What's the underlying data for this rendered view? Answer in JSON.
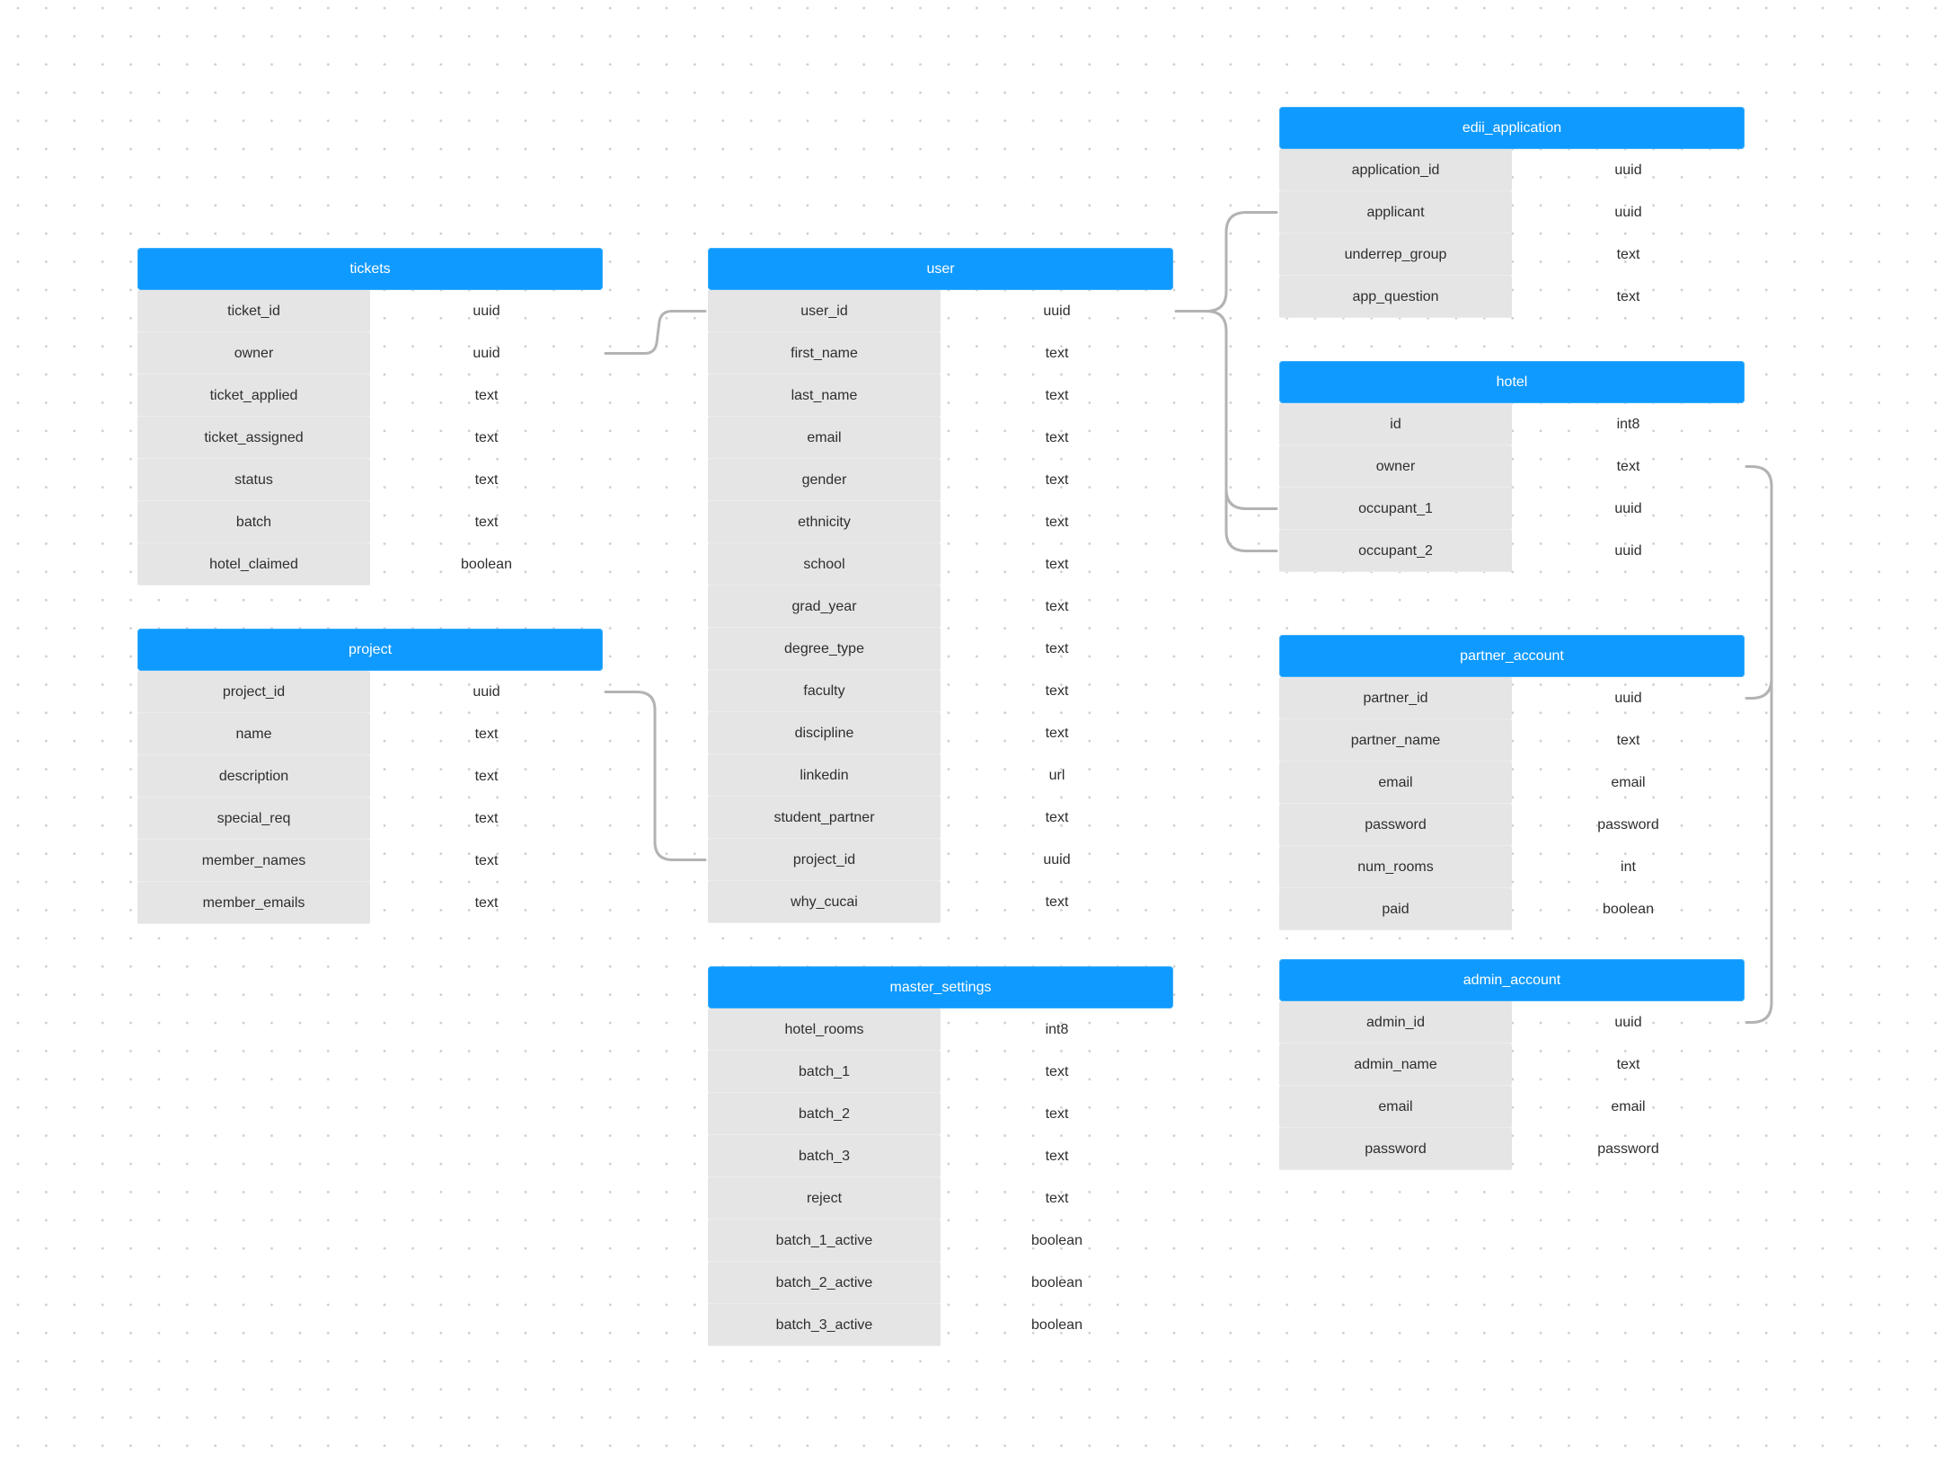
{
  "diagram": {
    "colors": {
      "header": "#0f9aff",
      "header_text": "#ffffff",
      "name_cell": "#e5e5e5",
      "text": "#2e2e2e",
      "connector": "#b3b3b3",
      "grid_dot": "#cfcfcf"
    },
    "tables": {
      "tickets": {
        "title": "tickets",
        "columns": [
          {
            "name": "ticket_id",
            "type": "uuid"
          },
          {
            "name": "owner",
            "type": "uuid"
          },
          {
            "name": "ticket_applied",
            "type": "text"
          },
          {
            "name": "ticket_assigned",
            "type": "text"
          },
          {
            "name": "status",
            "type": "text"
          },
          {
            "name": "batch",
            "type": "text"
          },
          {
            "name": "hotel_claimed",
            "type": "boolean"
          }
        ]
      },
      "project": {
        "title": "project",
        "columns": [
          {
            "name": "project_id",
            "type": "uuid"
          },
          {
            "name": "name",
            "type": "text"
          },
          {
            "name": "description",
            "type": "text"
          },
          {
            "name": "special_req",
            "type": "text"
          },
          {
            "name": "member_names",
            "type": "text"
          },
          {
            "name": "member_emails",
            "type": "text"
          }
        ]
      },
      "user": {
        "title": "user",
        "columns": [
          {
            "name": "user_id",
            "type": "uuid"
          },
          {
            "name": "first_name",
            "type": "text"
          },
          {
            "name": "last_name",
            "type": "text"
          },
          {
            "name": "email",
            "type": "text"
          },
          {
            "name": "gender",
            "type": "text"
          },
          {
            "name": "ethnicity",
            "type": "text"
          },
          {
            "name": "school",
            "type": "text"
          },
          {
            "name": "grad_year",
            "type": "text"
          },
          {
            "name": "degree_type",
            "type": "text"
          },
          {
            "name": "faculty",
            "type": "text"
          },
          {
            "name": "discipline",
            "type": "text"
          },
          {
            "name": "linkedin",
            "type": "url"
          },
          {
            "name": "student_partner",
            "type": "text"
          },
          {
            "name": "project_id",
            "type": "uuid"
          },
          {
            "name": "why_cucai",
            "type": "text"
          }
        ]
      },
      "master_settings": {
        "title": "master_settings",
        "columns": [
          {
            "name": "hotel_rooms",
            "type": "int8"
          },
          {
            "name": "batch_1",
            "type": "text"
          },
          {
            "name": "batch_2",
            "type": "text"
          },
          {
            "name": "batch_3",
            "type": "text"
          },
          {
            "name": "reject",
            "type": "text"
          },
          {
            "name": "batch_1_active",
            "type": "boolean"
          },
          {
            "name": "batch_2_active",
            "type": "boolean"
          },
          {
            "name": "batch_3_active",
            "type": "boolean"
          }
        ]
      },
      "edii_application": {
        "title": "edii_application",
        "columns": [
          {
            "name": "application_id",
            "type": "uuid"
          },
          {
            "name": "applicant",
            "type": "uuid"
          },
          {
            "name": "underrep_group",
            "type": "text"
          },
          {
            "name": "app_question",
            "type": "text"
          }
        ]
      },
      "hotel": {
        "title": "hotel",
        "columns": [
          {
            "name": "id",
            "type": "int8"
          },
          {
            "name": "owner",
            "type": "text"
          },
          {
            "name": "occupant_1",
            "type": "uuid"
          },
          {
            "name": "occupant_2",
            "type": "uuid"
          }
        ]
      },
      "partner_account": {
        "title": "partner_account",
        "columns": [
          {
            "name": "partner_id",
            "type": "uuid"
          },
          {
            "name": "partner_name",
            "type": "text"
          },
          {
            "name": "email",
            "type": "email"
          },
          {
            "name": "password",
            "type": "password"
          },
          {
            "name": "num_rooms",
            "type": "int"
          },
          {
            "name": "paid",
            "type": "boolean"
          }
        ]
      },
      "admin_account": {
        "title": "admin_account",
        "columns": [
          {
            "name": "admin_id",
            "type": "uuid"
          },
          {
            "name": "admin_name",
            "type": "text"
          },
          {
            "name": "email",
            "type": "email"
          },
          {
            "name": "password",
            "type": "password"
          }
        ]
      }
    },
    "relations": [
      {
        "from": "tickets.owner",
        "to": "user.user_id"
      },
      {
        "from": "project.project_id",
        "to": "user.project_id"
      },
      {
        "from": "user.user_id",
        "to": "edii_application.applicant"
      },
      {
        "from": "user.user_id",
        "to": "hotel.occupant_1"
      },
      {
        "from": "user.user_id",
        "to": "hotel.occupant_2"
      },
      {
        "from": "hotel.owner",
        "to": "partner_account.partner_id"
      },
      {
        "from": "hotel.owner",
        "to": "admin_account.admin_id"
      }
    ]
  }
}
